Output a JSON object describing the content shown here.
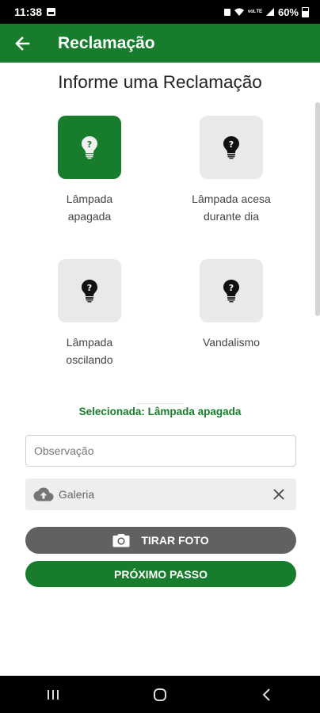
{
  "status_bar": {
    "time": "11:38",
    "battery": "60%",
    "signal_text": "ᵛᵒᴸᵀᴱ"
  },
  "app_bar": {
    "title": "Reclamação",
    "back_icon": "arrow-left-icon"
  },
  "main": {
    "title": "Informe uma Reclamação",
    "options": [
      {
        "label": "Lâmpada apagada",
        "selected": true
      },
      {
        "label": "Lâmpada acesa durante dia",
        "selected": false
      },
      {
        "label": "Lâmpada oscilando",
        "selected": false
      },
      {
        "label": "Vandalismo",
        "selected": false
      }
    ],
    "selected_text": "Selecionada: Lâmpada apagada",
    "observation_placeholder": "Observação",
    "gallery_label": "Galeria",
    "photo_button": "TIRAR FOTO",
    "next_button": "PRÓXIMO PASSO"
  },
  "colors": {
    "primary": "#177c2b",
    "option_bg": "#e9e9e9",
    "photo_button": "#616161"
  }
}
